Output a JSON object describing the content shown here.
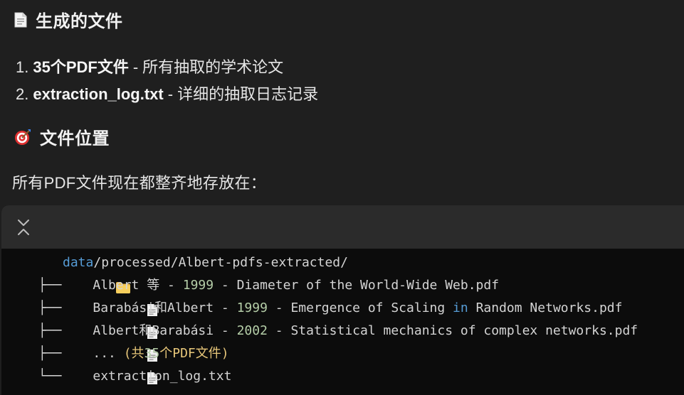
{
  "section1": {
    "icon": "document-icon",
    "title": "生成的文件"
  },
  "files_list": [
    {
      "num": "1.",
      "name": "35个PDF文件",
      "sep": "-",
      "desc": "所有抽取的学术论文"
    },
    {
      "num": "2.",
      "name": "extraction_log.txt",
      "sep": "-",
      "desc": "详细的抽取日志记录"
    }
  ],
  "section2": {
    "icon": "target-icon",
    "title": "文件位置"
  },
  "location_text": "所有PDF文件现在都整齐地存放在：",
  "code": {
    "collapse_icon": "collapse-chevrons-icon",
    "path_prefix": "data",
    "path_rest": "/processed/Albert-pdfs-extracted/",
    "tree_branch": "├── ",
    "tree_last": "└── ",
    "entries": [
      {
        "a": "Albert 等 - ",
        "year": "1999",
        "b": " - Diameter of the World-Wide Web.pdf"
      },
      {
        "a": "Barabási和Albert - ",
        "year": "1999",
        "b": " - Emergence of Scaling ",
        "kw": "in",
        "c": " Random Networks.pdf"
      },
      {
        "a": "Albert和Barabási - ",
        "year": "2002",
        "b": " - Statistical mechanics of complex networks.pdf"
      }
    ],
    "more_dots": "... ",
    "more_open": "(共",
    "more_count": "35",
    "more_rest": "个PDF文件)",
    "log_file": "extraction_log.txt"
  },
  "colors": {
    "background": "#1f1f1f",
    "code_background": "#0c0c0c",
    "code_header": "#2b2b2b",
    "keyword_blue": "#569cd6",
    "number_green": "#b5cea8",
    "folder_yellow": "#f2c14e"
  }
}
